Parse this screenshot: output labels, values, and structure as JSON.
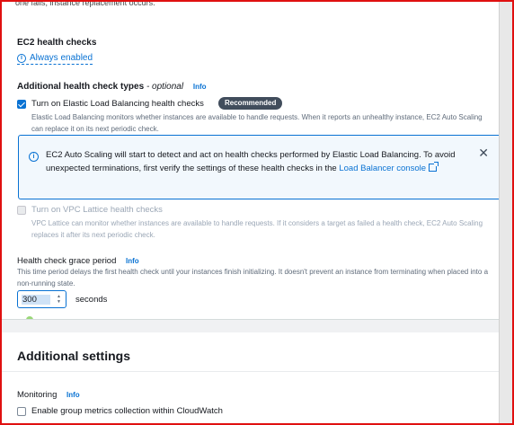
{
  "top_partial_text": "one fails, instance replacement occurs.",
  "ec2_health": {
    "label": "EC2 health checks",
    "status": "Always enabled"
  },
  "additional_types": {
    "label": "Additional health check types",
    "optional": "- optional",
    "info": "Info"
  },
  "elb_check": {
    "label": "Turn on Elastic Load Balancing health checks",
    "badge": "Recommended",
    "description": "Elastic Load Balancing monitors whether instances are available to handle requests. When it reports an unhealthy instance, EC2 Auto Scaling can replace it on its next periodic check.",
    "checked": true
  },
  "alert": {
    "text": "EC2 Auto Scaling will start to detect and act on health checks performed by Elastic Load Balancing. To avoid unexpected terminations, first verify the settings of these health checks in the",
    "link": "Load Balancer console",
    "close_label": "✕"
  },
  "vpc_check": {
    "label": "Turn on VPC Lattice health checks",
    "description": "VPC Lattice can monitor whether instances are available to handle requests. If it considers a target as failed a health check, EC2 Auto Scaling replaces it after its next periodic check.",
    "disabled": true
  },
  "grace_period": {
    "label": "Health check grace period",
    "info": "Info",
    "description": "This time period delays the first health check until your instances finish initializing. It doesn't prevent an instance from terminating when placed into a non-running state.",
    "value": "300",
    "unit": "seconds"
  },
  "additional_settings": {
    "title": "Additional settings",
    "monitoring_label": "Monitoring",
    "info": "Info",
    "group_metrics_label": "Enable group metrics collection within CloudWatch",
    "group_metrics_checked": false
  },
  "colors": {
    "accent": "#0972d3",
    "frame": "#e01010",
    "badge": "#414d5c"
  }
}
